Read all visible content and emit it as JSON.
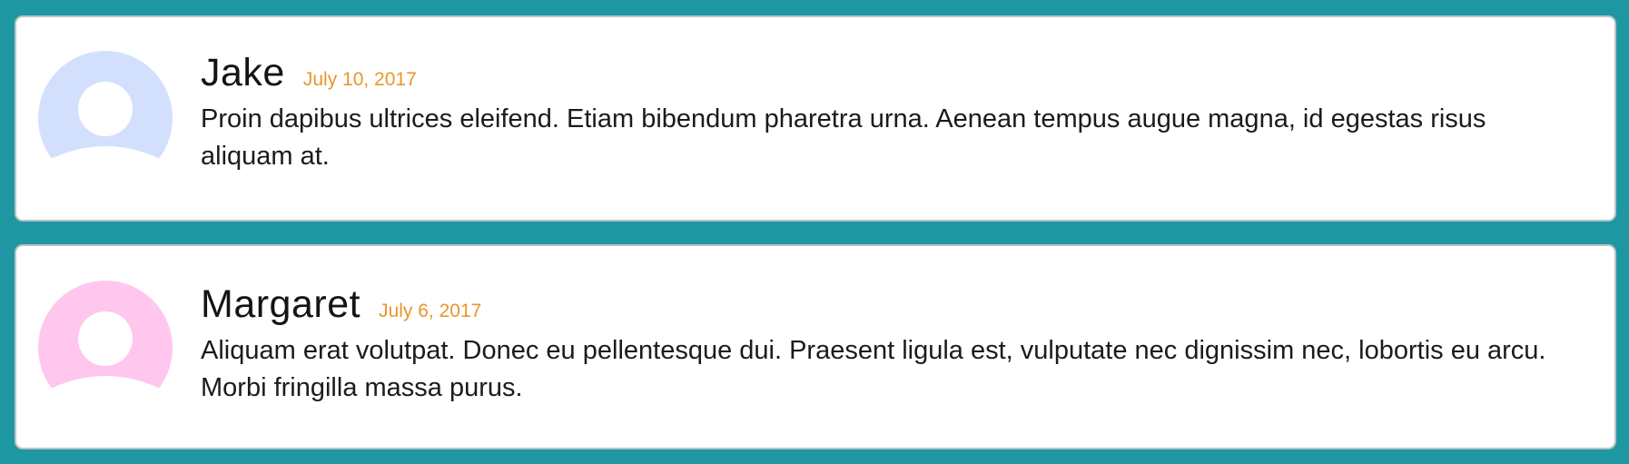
{
  "colors": {
    "page_background": "#1e97a2",
    "card_background": "#ffffff",
    "date_color": "#e8962e",
    "avatar_blue": "#d3e0fd",
    "avatar_pink": "#ffc6ee"
  },
  "comments": [
    {
      "author": "Jake",
      "date": "July 10, 2017",
      "text": "Proin dapibus ultrices eleifend. Etiam bibendum pharetra urna. Aenean tempus augue magna, id egestas risus aliquam at.",
      "avatar_icon": "user-silhouette-icon",
      "avatar_color": "#d3e0fd"
    },
    {
      "author": "Margaret",
      "date": "July 6, 2017",
      "text": "Aliquam erat volutpat. Donec eu pellentesque dui. Praesent ligula est, vulputate nec dignissim nec, lobortis eu arcu. Morbi fringilla massa purus.",
      "avatar_icon": "user-silhouette-icon",
      "avatar_color": "#ffc6ee"
    }
  ]
}
